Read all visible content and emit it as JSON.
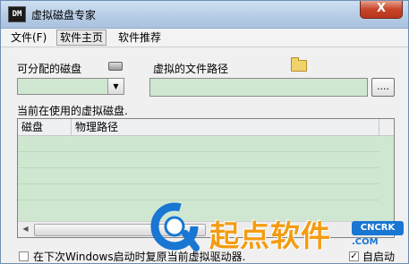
{
  "window": {
    "title": "虚拟磁盘专家",
    "icon_text": "DM",
    "close_label": "X"
  },
  "menu": [
    {
      "label": "文件(F)"
    },
    {
      "label": "软件主页"
    },
    {
      "label": "软件推荐"
    }
  ],
  "form": {
    "disk_label": "可分配的磁盘",
    "path_label": "虚拟的文件路径",
    "disk_value": "",
    "path_value": "",
    "browse_label": "....",
    "dropdown_icon": "▼"
  },
  "table": {
    "caption": "当前在使用的虚拟磁盘.",
    "columns": [
      "磁盘",
      "物理路径"
    ],
    "rows": []
  },
  "bottom": {
    "restore_label": "在下次Windows启动时复原当前虚拟驱动器.",
    "restore_checked": false,
    "autostart_label": "自启动",
    "autostart_checked": true
  },
  "watermark": {
    "text": "起点软件",
    "url": "CNCRK",
    "url2": ".COM"
  },
  "colors": {
    "field_bg": "#cfe7d1",
    "title_gradient": "#b7cde6",
    "close_red": "#c7452a",
    "watermark_orange": "#f39c12",
    "watermark_blue": "#1976d2"
  }
}
